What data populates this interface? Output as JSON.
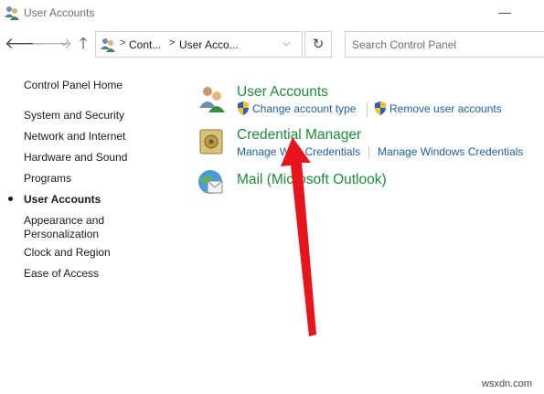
{
  "window": {
    "title": "User Accounts"
  },
  "nav": {
    "back_icon": "arrow-left-icon",
    "forward_icon": "arrow-right-icon",
    "recent_icon": "chevron-down-icon",
    "up_icon": "arrow-up-icon",
    "refresh_icon": "refresh-icon"
  },
  "address": {
    "crumbs": [
      "Cont...",
      "User Acco..."
    ]
  },
  "search": {
    "placeholder": "Search Control Panel"
  },
  "sidebar": {
    "home": "Control Panel Home",
    "items": [
      {
        "label": "System and Security"
      },
      {
        "label": "Network and Internet"
      },
      {
        "label": "Hardware and Sound"
      },
      {
        "label": "Programs"
      },
      {
        "label": "User Accounts",
        "active": true
      },
      {
        "label": "Appearance and\nPersonalization"
      },
      {
        "label": "Clock and Region"
      },
      {
        "label": "Ease of Access"
      }
    ]
  },
  "categories": [
    {
      "title": "User Accounts",
      "icon": "users-icon",
      "links": [
        "Change account type",
        "Remove user accounts"
      ]
    },
    {
      "title": "Credential Manager",
      "icon": "vault-icon",
      "links": [
        "Manage Web Credentials",
        "Manage Windows Credentials"
      ]
    },
    {
      "title": "Mail (Microsoft Outlook)",
      "icon": "mail-icon",
      "links": []
    }
  ],
  "colors": {
    "category_title": "#1e8a3a",
    "link": "#1f5fa6",
    "annotation_arrow": "#e8141b"
  },
  "watermark": "wsxdn.com"
}
